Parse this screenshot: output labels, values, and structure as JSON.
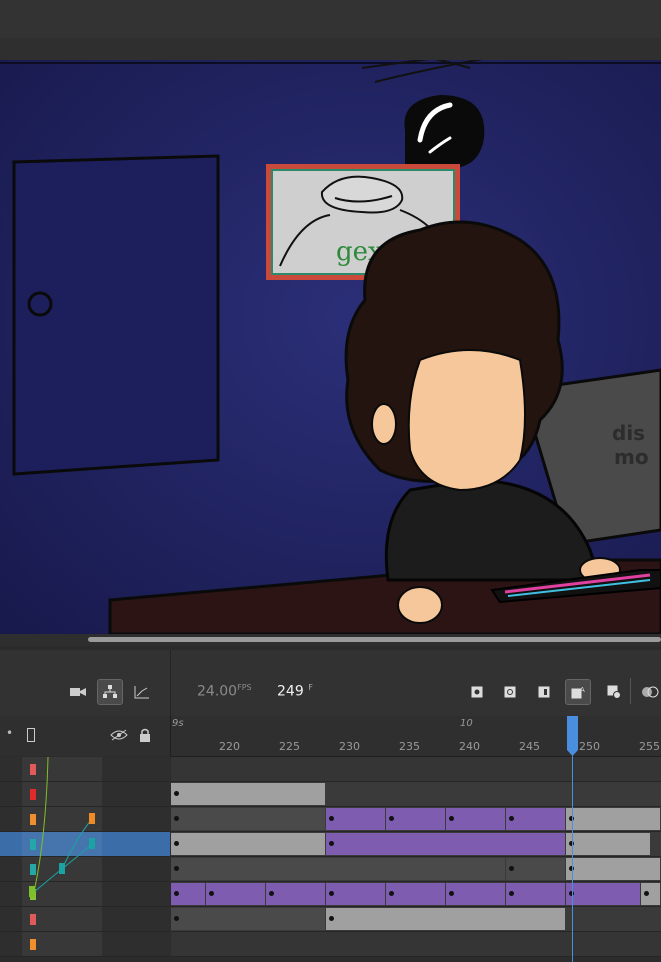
{
  "stage": {
    "poster_text": "gex",
    "monitor_text_line1": "dis",
    "monitor_text_line2": "mo"
  },
  "timeline": {
    "toolbar": {
      "camera_icon": "camera-icon",
      "parenting_icon": "layer-parenting-icon",
      "graph_icon": "graph-icon",
      "fps_value": "24.00",
      "fps_unit": "FPS",
      "frame_value": "249",
      "frame_unit": "F"
    },
    "ruler": {
      "seconds_labels": [
        "9s",
        "10"
      ],
      "frame_labels": [
        "220",
        "225",
        "230",
        "235",
        "240",
        "245",
        "250",
        "255"
      ]
    },
    "layer_header": {
      "dot": "•",
      "outline_icon": "outline-icon",
      "eye_icon": "eye-hidden-icon",
      "lock_icon": "lock-icon"
    },
    "layers": [
      {
        "chip_color": "#e05252"
      },
      {
        "chip_color": "#e02020"
      },
      {
        "chip_color": "#f08a24",
        "selected": false
      },
      {
        "chip_color": "#1aa3a3",
        "selected": true
      },
      {
        "chip_color": "#1aa3a3"
      },
      {
        "chip_color": "#7fbf2a"
      },
      {
        "chip_color": "#e05252"
      },
      {
        "chip_color": "#f08a24"
      }
    ],
    "colors": {
      "selected_row": "#3b6ea8",
      "tween": "#7e5db0",
      "static": "#a0a0a0",
      "playhead": "#4a8ee0"
    }
  }
}
